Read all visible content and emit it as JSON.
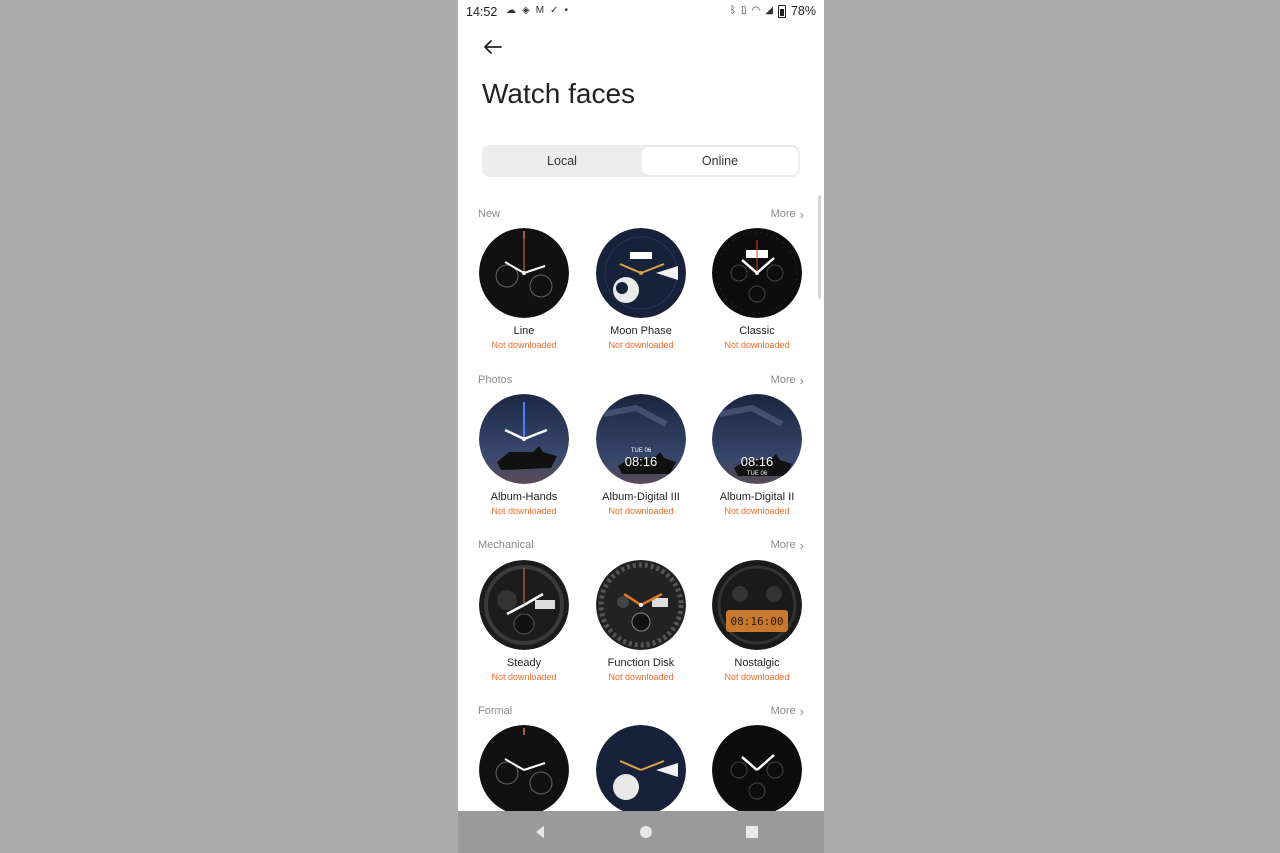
{
  "status_bar": {
    "time": "14:52",
    "battery": "78%"
  },
  "page_title": "Watch faces",
  "tabs": [
    {
      "label": "Local"
    },
    {
      "label": "Online"
    }
  ],
  "more_label": "More",
  "sections": [
    {
      "label": "New",
      "faces": [
        {
          "name": "Line",
          "status": "Not downloaded"
        },
        {
          "name": "Moon Phase",
          "status": "Not downloaded"
        },
        {
          "name": "Classic",
          "status": "Not downloaded"
        }
      ]
    },
    {
      "label": "Photos",
      "faces": [
        {
          "name": "Album-Hands",
          "status": "Not downloaded"
        },
        {
          "name": "Album-Digital III",
          "status": "Not downloaded",
          "display_time": "08:16",
          "display_date": "TUE 06"
        },
        {
          "name": "Album-Digital II",
          "status": "Not downloaded",
          "display_time": "08:16",
          "display_date": "TUE 06"
        }
      ]
    },
    {
      "label": "Mechanical",
      "faces": [
        {
          "name": "Steady",
          "status": "Not downloaded"
        },
        {
          "name": "Function Disk",
          "status": "Not downloaded"
        },
        {
          "name": "Nostalgic",
          "status": "Not downloaded",
          "display_time": "08:16:00"
        }
      ]
    },
    {
      "label": "Formal",
      "faces": [
        {},
        {},
        {}
      ]
    }
  ],
  "colors": {
    "accent": "#f06a2a",
    "tab_bg": "#ececec",
    "backdrop": "#aaaaaa",
    "navbar": "#9a9a9a"
  },
  "icons": [
    "back-arrow-icon",
    "chevron-right-icon",
    "bluetooth-icon",
    "vibrate-icon",
    "wifi-icon",
    "signal-icon",
    "battery-icon",
    "nav-back-icon",
    "nav-home-icon",
    "nav-recents-icon"
  ]
}
